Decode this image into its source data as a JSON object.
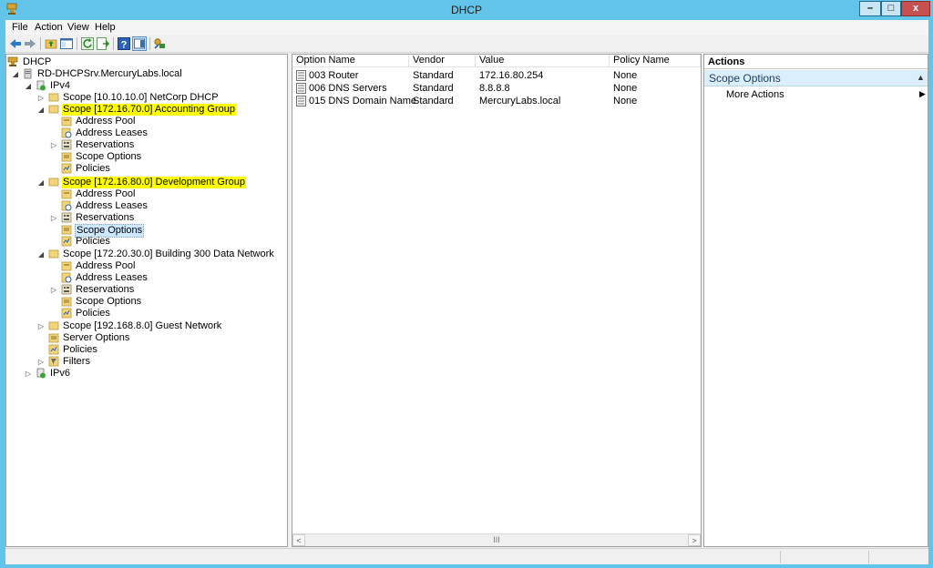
{
  "window": {
    "title": "DHCP",
    "minimize": "–",
    "maximize": "□",
    "close": "x"
  },
  "menu": [
    "File",
    "Action",
    "View",
    "Help"
  ],
  "toolbar": [
    "back-arrow-icon",
    "forward-arrow-icon",
    "up-folder-icon",
    "show-hide-tree-icon",
    "refresh-icon",
    "export-list-icon",
    "help-icon",
    "show-action-pane-icon",
    "manage-authorized-servers-icon"
  ],
  "tree": {
    "root": "DHCP",
    "server": "RD-DHCPSrv.MercuryLabs.local",
    "ipv4": "IPv4",
    "scope1": "Scope [10.10.10.0] NetCorp DHCP",
    "scope2": "Scope [172.16.70.0] Accounting Group",
    "scope2_pool": "Address Pool",
    "scope2_leases": "Address Leases",
    "scope2_res": "Reservations",
    "scope2_opts": "Scope Options",
    "scope2_pol": "Policies",
    "scope3": "Scope [172.16.80.0] Development Group",
    "scope3_pool": "Address Pool",
    "scope3_leases": "Address Leases",
    "scope3_res": "Reservations",
    "scope3_opts": "Scope Options",
    "scope3_pol": "Policies",
    "scope4": "Scope [172.20.30.0] Building 300 Data Network",
    "scope4_pool": "Address Pool",
    "scope4_leases": "Address Leases",
    "scope4_res": "Reservations",
    "scope4_opts": "Scope Options",
    "scope4_pol": "Policies",
    "scope5": "Scope [192.168.8.0] Guest Network",
    "server_options": "Server Options",
    "policies": "Policies",
    "filters": "Filters",
    "ipv6": "IPv6"
  },
  "list": {
    "columns": [
      "Option Name",
      "Vendor",
      "Value",
      "Policy Name"
    ],
    "rows": [
      [
        "003 Router",
        "Standard",
        "172.16.80.254",
        "None"
      ],
      [
        "006 DNS Servers",
        "Standard",
        "8.8.8.8",
        "None"
      ],
      [
        "015 DNS Domain Name",
        "Standard",
        "MercuryLabs.local",
        "None"
      ]
    ],
    "scroll_left": "<",
    "scroll_thumb": "III",
    "scroll_right": ">"
  },
  "actions": {
    "header": "Actions",
    "section": "Scope Options",
    "item": "More Actions"
  },
  "colors": {
    "titlebar": "#63c4ea",
    "highlight": "#ffff00",
    "selection": "#cde8ff",
    "actions_section": "#dbeefb"
  }
}
